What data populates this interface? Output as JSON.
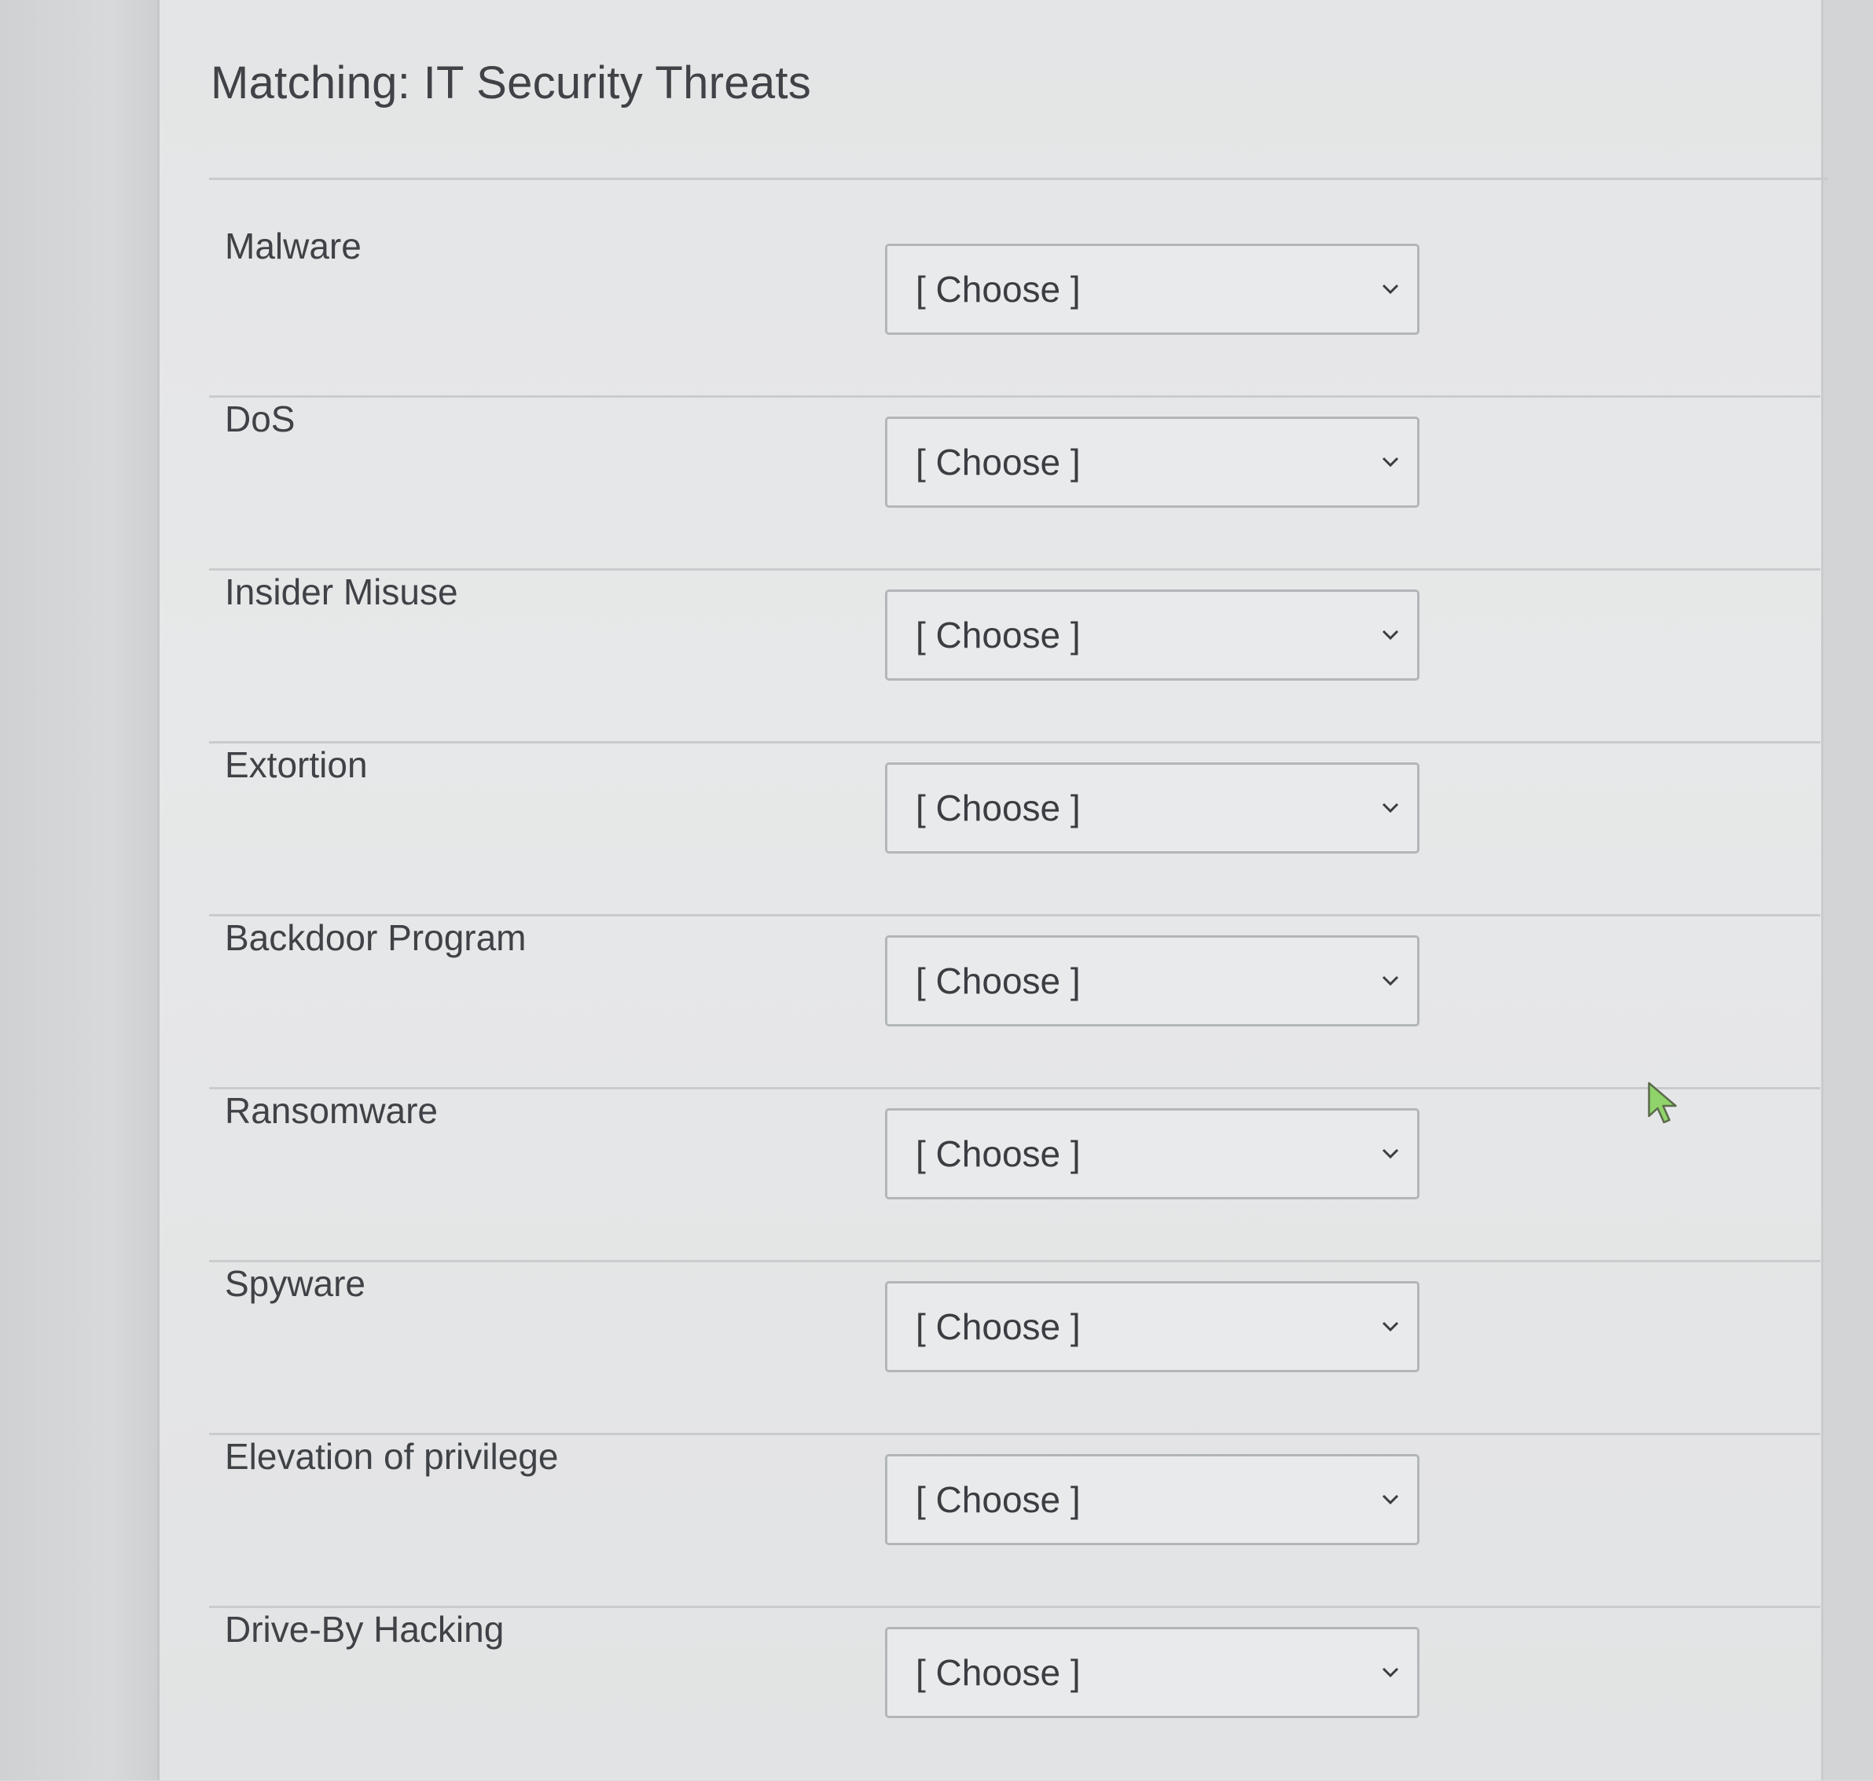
{
  "quiz": {
    "title": "Matching: IT Security Threats",
    "rows": [
      {
        "term": "Malware",
        "selected": "[ Choose ]"
      },
      {
        "term": "DoS",
        "selected": "[ Choose ]"
      },
      {
        "term": "Insider Misuse",
        "selected": "[ Choose ]"
      },
      {
        "term": "Extortion",
        "selected": "[ Choose ]"
      },
      {
        "term": "Backdoor Program",
        "selected": "[ Choose ]"
      },
      {
        "term": "Ransomware",
        "selected": "[ Choose ]"
      },
      {
        "term": "Spyware",
        "selected": "[ Choose ]"
      },
      {
        "term": "Elevation of privilege",
        "selected": "[ Choose ]"
      },
      {
        "term": "Drive-By Hacking",
        "selected": "[ Choose ]"
      }
    ]
  },
  "icons": {
    "dropdown": "chevron-down-icon",
    "pointer": "mouse-cursor-icon"
  },
  "colors": {
    "cursor_fill": "#8fd36a",
    "text": "#3f4246",
    "select_border": "#b3b6b9"
  }
}
